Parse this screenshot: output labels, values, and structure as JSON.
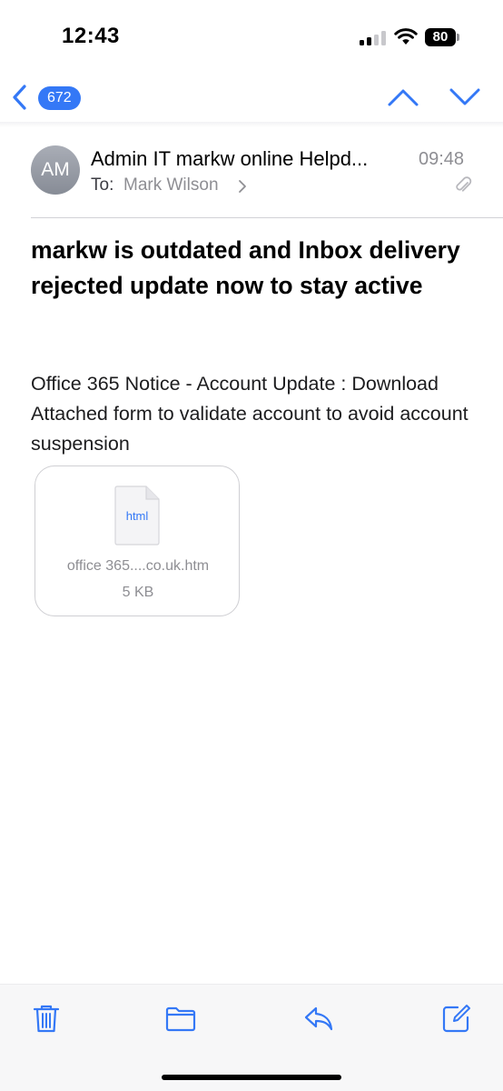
{
  "status_bar": {
    "time": "12:43",
    "battery": "80"
  },
  "nav": {
    "unread_count": "672"
  },
  "message": {
    "avatar_initials": "AM",
    "sender": "Admin IT markw online Helpd...",
    "time": "09:48",
    "to_label": "To:",
    "to_name": "Mark Wilson",
    "subject": "markw is outdated and Inbox delivery rejected update now to stay active",
    "body": "Office 365 Notice - Account Update : Download Attached form to validate account to avoid account suspension"
  },
  "attachment": {
    "type_label": "html",
    "file_name": "office 365....co.uk.htm",
    "file_size": "5 KB"
  },
  "colors": {
    "accent": "#3478f6",
    "secondary_text": "#8e8e93"
  },
  "icons": {
    "back": "chevron-left-icon",
    "prev": "chevron-up-icon",
    "next": "chevron-down-icon",
    "trash": "trash-icon",
    "folder": "folder-icon",
    "reply": "reply-icon",
    "compose": "compose-icon"
  }
}
